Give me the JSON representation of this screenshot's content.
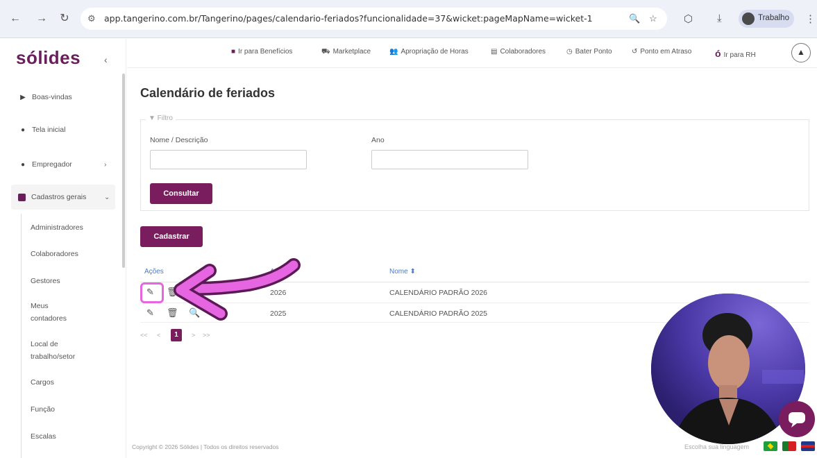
{
  "browser": {
    "url": "app.tangerino.com.br/Tangerino/pages/calendario-feriados?funcionalidade=37&wicket:pageMapName=wicket-1",
    "profile_label": "Trabalho"
  },
  "sidebar": {
    "logo": "sólides",
    "items": [
      {
        "label": "Boas-vindas"
      },
      {
        "label": "Tela inicial"
      },
      {
        "label": "Empregador"
      },
      {
        "label": "Cadastros gerais"
      }
    ],
    "sub_items": [
      {
        "label": "Administradores"
      },
      {
        "label": "Colaboradores"
      },
      {
        "label": "Gestores"
      },
      {
        "label": "Meus contadores"
      },
      {
        "label": "Local de trabalho/setor"
      },
      {
        "label": "Cargos"
      },
      {
        "label": "Função"
      },
      {
        "label": "Escalas"
      }
    ]
  },
  "topnav": {
    "items": [
      {
        "label": "Ir para Benefícios"
      },
      {
        "label": "Marketplace"
      },
      {
        "label": "Apropriação de Horas"
      },
      {
        "label": "Colaboradores"
      },
      {
        "label": "Bater Ponto"
      },
      {
        "label": "Ponto em Atraso"
      },
      {
        "label": "Ir para RH"
      }
    ]
  },
  "page": {
    "title": "Calendário de feriados",
    "filter_legend": "▼ Filtro",
    "name_label": "Nome / Descrição",
    "year_label": "Ano",
    "search_button": "Consultar",
    "register_button": "Cadastrar"
  },
  "table": {
    "headers": {
      "actions": "Ações",
      "year": "Ano",
      "name": "Nome"
    },
    "rows": [
      {
        "year": "2026",
        "name": "CALENDÁRIO PADRÃO 2026"
      },
      {
        "year": "2025",
        "name": "CALENDÁRIO PADRÃO 2025"
      }
    ]
  },
  "pagination": {
    "first": "<<",
    "prev": "<",
    "current": "1",
    "next": ">",
    "last": ">>"
  },
  "footer": {
    "copyright": "Copyright © 2026 Sólides | Todos os direitos reservados",
    "language_label": "Escolha sua linguagem"
  },
  "colors": {
    "brand": "#7a1d5e",
    "highlight": "#e566e0"
  }
}
